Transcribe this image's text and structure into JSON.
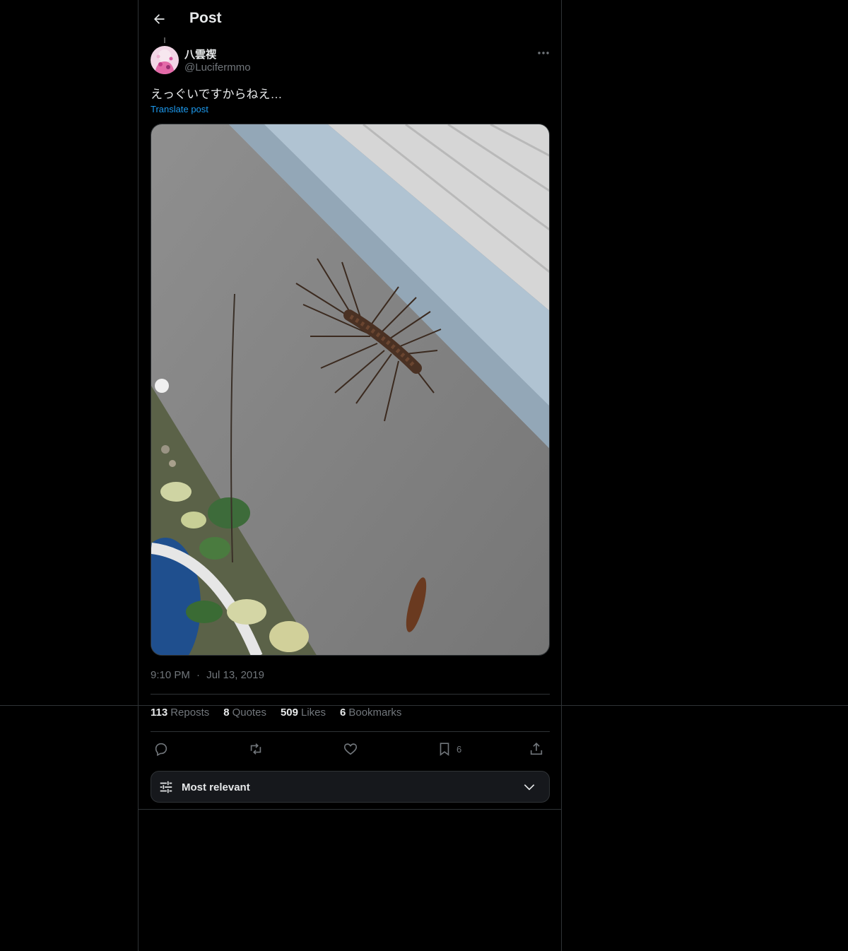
{
  "header": {
    "title": "Post"
  },
  "post": {
    "author_name": "八雲禊",
    "author_handle": "@Lucifermmo",
    "text": "えっぐいですからねえ…",
    "translate_label": "Translate post",
    "time": "9:10 PM",
    "date": "Jul 13, 2019",
    "dot": "·"
  },
  "stats": {
    "reposts_count": "113",
    "reposts_label": "Reposts",
    "quotes_count": "8",
    "quotes_label": "Quotes",
    "likes_count": "509",
    "likes_label": "Likes",
    "bookmarks_count": "6",
    "bookmarks_label": "Bookmarks"
  },
  "actions": {
    "bookmark_count": "6"
  },
  "sort": {
    "label": "Most relevant"
  },
  "colors": {
    "accent": "#1d9bf0",
    "muted": "#71767b",
    "text": "#e7e9ea",
    "border": "#2f3336"
  }
}
